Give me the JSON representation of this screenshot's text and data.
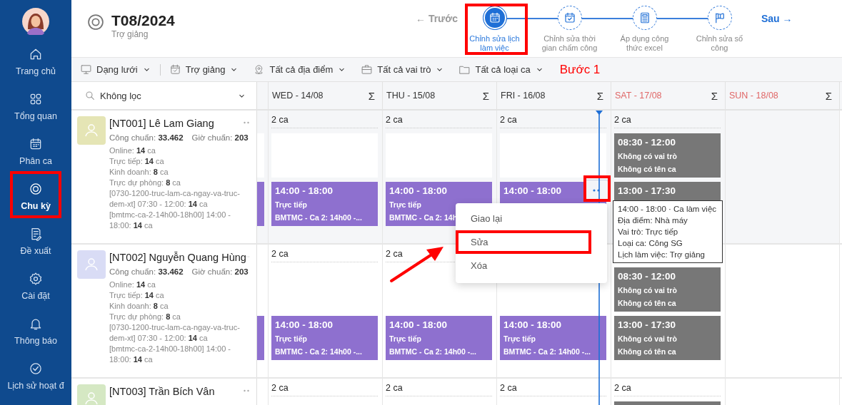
{
  "sidebar": {
    "items": [
      {
        "label": "Trang chủ",
        "selected": false,
        "marked": false
      },
      {
        "label": "Tổng quan",
        "selected": false,
        "marked": false
      },
      {
        "label": "Phân ca",
        "selected": false,
        "marked": false
      },
      {
        "label": "Chu kỳ",
        "selected": true,
        "marked": true
      },
      {
        "label": "Đề xuất",
        "selected": false,
        "marked": false
      },
      {
        "label": "Cài đặt",
        "selected": false,
        "marked": false
      },
      {
        "label": "Thông báo",
        "selected": false,
        "marked": false
      },
      {
        "label": "Lịch sử hoạt đ",
        "selected": false,
        "marked": false
      }
    ]
  },
  "header": {
    "title": "T08/2024",
    "subtitle": "Trợ giảng",
    "prev": "← Trước",
    "next": "Sau →",
    "steps": [
      {
        "label": "Chỉnh sửa lịch làm việc",
        "selected": true,
        "marked": true
      },
      {
        "label": "Chỉnh sửa thời gian chấm công",
        "selected": false,
        "marked": false
      },
      {
        "label": "Áp dụng công thức excel",
        "selected": false,
        "marked": false
      },
      {
        "label": "Chỉnh sửa số công",
        "selected": false,
        "marked": false
      }
    ]
  },
  "toolbar": {
    "filters": [
      "Dạng lưới",
      "Trợ giảng",
      "Tất cả địa điểm",
      "Tất cả vai trò",
      "Tất cả loại ca"
    ],
    "annotation": "Bước 1"
  },
  "grid": {
    "filter": "Không lọc",
    "days": [
      {
        "kind": "partial"
      },
      {
        "label": "WED - 14/08",
        "sum": "Σ",
        "weekend": false
      },
      {
        "label": "THU - 15/08",
        "sum": "Σ",
        "weekend": false
      },
      {
        "label": "FRI - 16/08",
        "sum": "Σ",
        "weekend": false,
        "now_marker": true
      },
      {
        "label": "SAT - 17/08",
        "sum": "Σ",
        "weekend": true
      },
      {
        "label": "SUN - 18/08",
        "sum": "Σ",
        "weekend": true
      }
    ],
    "rows": [
      {
        "name": "[NT001] Lê Lam Giang",
        "color": "#e5e5b5",
        "highlighted": true,
        "standard_work": "Công chuẩn: **33.462**",
        "standard_hours": "Giờ chuẩn: **203**",
        "stats": [
          "Online: **14** ca",
          "Trực tiếp: **14** ca",
          "Kinh doanh: **8** ca",
          "Trực dự phòng: **8** ca",
          "[0730-1200-truc-lam-ca-ngay-va-truc-dem-xt] 07:30 - 12:00: **14** ca",
          "[bmtmc-ca-2-14h00-18h00] 14:00 - 18:00: **14** ca"
        ],
        "cells": [
          {
            "shifts": [
              {
                "kind": "blank"
              },
              {
                "kind": "work"
              }
            ]
          },
          {
            "count": "2 ca",
            "shifts": [
              {
                "kind": "blank"
              },
              {
                "kind": "work",
                "time": "14:00 - 18:00",
                "role": "Trực tiếp",
                "name": "BMTMC - Ca 2: 14h00 -..."
              }
            ]
          },
          {
            "count": "2 ca",
            "shifts": [
              {
                "kind": "blank"
              },
              {
                "kind": "work",
                "time": "14:00 - 18:00",
                "role": "Trực tiếp",
                "name": "BMTMC - Ca 2: 14h"
              }
            ]
          },
          {
            "count": "2 ca",
            "shifts": [
              {
                "kind": "blank"
              },
              {
                "kind": "work",
                "time": "14:00 - 18:00",
                "more_button": true,
                "marked": true
              }
            ]
          },
          {
            "count": "2 ca",
            "shifts": [
              {
                "kind": "unassigned",
                "time": "08:30 - 12:00",
                "role": "Không có vai trò",
                "name": "Không có tên ca"
              },
              {
                "kind": "unassigned",
                "time": "13:00 - 17:30"
              }
            ]
          },
          {}
        ]
      },
      {
        "name": "[NT002] Nguyễn Quang Hùng",
        "color": "#d9dcf5",
        "highlighted": false,
        "standard_work": "Công chuẩn: **33.462**",
        "standard_hours": "Giờ chuẩn: **203**",
        "stats": [
          "Online: **14** ca",
          "Trực tiếp: **14** ca",
          "Kinh doanh: **8** ca",
          "Trực dự phòng: **8** ca",
          "[0730-1200-truc-lam-ca-ngay-va-truc-dem-xt] 07:30 - 12:00: **14** ca",
          "[bmtmc-ca-2-14h00-18h00] 14:00 - 18:00: **14** ca"
        ],
        "cells": [
          {
            "shifts": [
              {
                "kind": "gap"
              },
              {
                "kind": "work"
              }
            ]
          },
          {
            "count": "2 ca",
            "shifts": [
              {
                "kind": "gap"
              },
              {
                "kind": "work",
                "time": "14:00 - 18:00",
                "role": "Trực tiếp",
                "name": "BMTMC - Ca 2: 14h00 -..."
              }
            ]
          },
          {
            "count": "2 ca",
            "shifts": [
              {
                "kind": "gap"
              },
              {
                "kind": "work",
                "time": "14:00 - 18:00",
                "role": "Trực tiếp",
                "name": "BMTMC - Ca 2: 14h00 -..."
              }
            ]
          },
          {
            "shifts": [
              {
                "kind": "gap"
              },
              {
                "kind": "work",
                "time": "14:00 - 18:00",
                "role": "Trực tiếp",
                "name": "BMTMC - Ca 2: 14h00 -..."
              }
            ]
          },
          {
            "shifts": [
              {
                "kind": "unassigned",
                "time": "08:30 - 12:00",
                "role": "Không có vai trò",
                "name": "Không có tên ca"
              },
              {
                "kind": "unassigned",
                "time": "13:00 - 17:30",
                "role": "Không có vai trò",
                "name": "Không có tên ca"
              }
            ]
          },
          {}
        ]
      },
      {
        "name": "[NT003] Trần Bích Vân",
        "color": "#d5e8c3",
        "highlighted": false,
        "cells": [
          {},
          {
            "count": "2 ca"
          },
          {
            "count": "2 ca"
          },
          {
            "count": "2 ca"
          },
          {
            "count": "2 ca",
            "shifts": [
              {
                "kind": "unassigned"
              }
            ]
          },
          {}
        ]
      }
    ]
  },
  "context_menu": {
    "items": [
      {
        "label": "Giao lại",
        "marked": false
      },
      {
        "label": "Sửa",
        "marked": true
      },
      {
        "label": "Xóa",
        "marked": false
      }
    ]
  },
  "tooltip": {
    "lines": [
      "14:00 - 18:00 · Ca làm việc",
      "Địa điểm: Nhà máy",
      "Vai trò: Trực tiếp",
      "Loại ca: Công SG",
      "Lịch làm việc: Trợ giảng"
    ]
  },
  "pointer_arrow": true
}
